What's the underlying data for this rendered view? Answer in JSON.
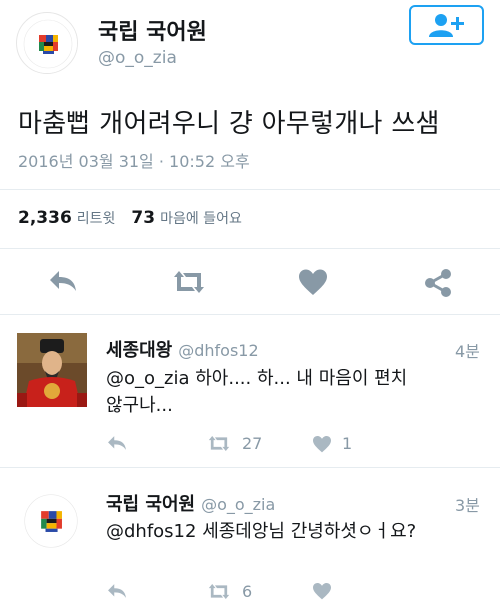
{
  "main_tweet": {
    "avatar_logo_text": "THE NATIONAL INSTITUTE OF THE KOREAN LANGUAGE",
    "avatar_logo_caption": "국립국어원",
    "display_name": "국립 국어원",
    "handle": "@o_o_zia",
    "text": "마춤뻡 개어려우니 걍 아무렇개나 쓰샘",
    "timestamp": "2016년 03월 31일 · 10:52 오후",
    "retweets_count": "2,336",
    "retweets_label": "리트윗",
    "likes_count": "73",
    "likes_label": "마음에 들어요",
    "actions": [
      "reply-icon",
      "retweet-icon",
      "heart-icon",
      "share-icon"
    ],
    "follow_button_icon": "add-user-icon"
  },
  "replies": [
    {
      "avatar": "sejong-portrait",
      "display_name": "세종대왕",
      "handle": "@dhfos12",
      "time": "4분",
      "mention": "@o_o_zia",
      "line1_rest": " 하아.... 하... 내 마음이 편치",
      "line2": "않구나...",
      "retweets": "27",
      "likes": "1"
    },
    {
      "avatar": "institute-logo",
      "display_name": "국립 국어원",
      "handle": "@o_o_zia",
      "time": "3분",
      "mention": "@dhfos12",
      "line1_rest": " 세종데앙님 간녕하셧ㅇㅓ요?",
      "retweets": "6"
    }
  ],
  "colors": {
    "accent": "#1da1f2",
    "icon_gray": "#8899a6",
    "text": "#14171a"
  }
}
